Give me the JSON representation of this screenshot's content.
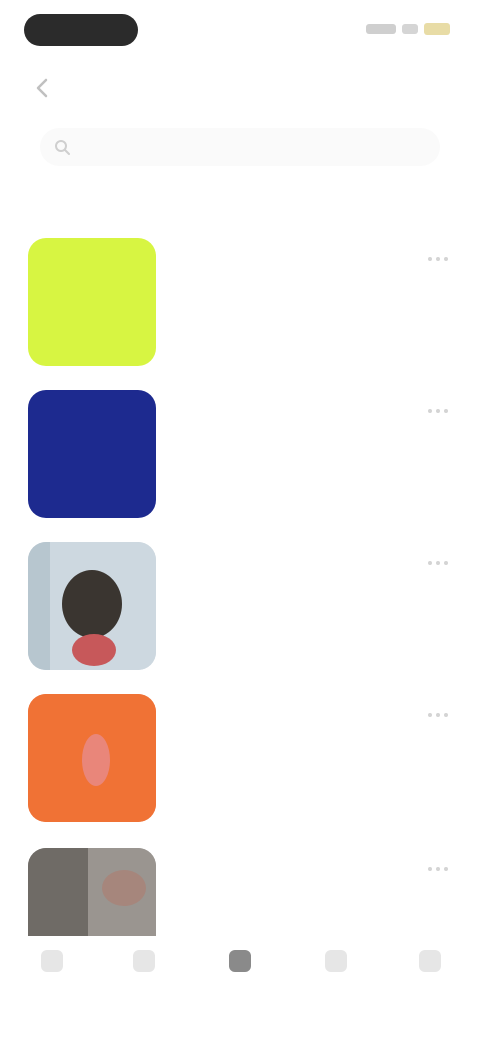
{
  "header": {
    "title": "",
    "back_icon": "chevron-left-icon"
  },
  "search": {
    "placeholder": ""
  },
  "section": {
    "label": ""
  },
  "items": [
    {
      "title": "",
      "subtitle": "",
      "meta": "",
      "thumb_color": "#d7f542"
    },
    {
      "title": "",
      "subtitle": "",
      "meta": "",
      "thumb_color": "#1d2a8f"
    },
    {
      "title": "",
      "subtitle": "",
      "meta": "",
      "thumb_color": "#c9d4dc"
    },
    {
      "title": "",
      "subtitle": "",
      "meta": "",
      "thumb_color": "#f0703a"
    },
    {
      "title": "",
      "subtitle": "",
      "meta": "",
      "thumb_color": "#8f8a86"
    }
  ],
  "tabs": [
    {
      "label": "",
      "icon": "home-icon",
      "active": false
    },
    {
      "label": "",
      "icon": "search-icon",
      "active": false
    },
    {
      "label": "",
      "icon": "library-icon",
      "active": true
    },
    {
      "label": "",
      "icon": "bell-icon",
      "active": false
    },
    {
      "label": "",
      "icon": "profile-icon",
      "active": false
    }
  ],
  "colors": {
    "accent": "#8a8a8a",
    "background": "#ffffff"
  }
}
